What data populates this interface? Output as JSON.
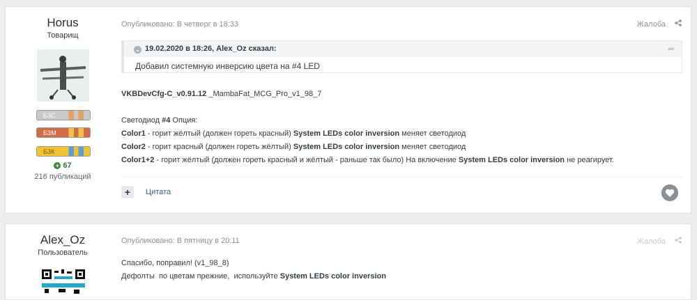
{
  "posts": [
    {
      "author": "Horus",
      "rank": "Товарищ",
      "badges": [
        "БЗС",
        "БЗМ",
        "БЗК"
      ],
      "reputation": "67",
      "posts_count": "216 публикаций",
      "published": "Опубликовано: В четверг в 18:33",
      "report": "Жалоба",
      "quote": {
        "header": "19.02.2020 в 18:26, Alex_Oz сказал:",
        "body": "Добавил системную инверсию цвета на #4 LED"
      },
      "lines": [
        {
          "bold": "VKBDevCfg-C_v0.91.12",
          "text": " _MambaFat_MCG_Pro_v1_98_7"
        },
        {
          "prefix": "Светодиод ",
          "bold": "#4",
          "text": " Опция:"
        },
        {
          "bold": "Color1",
          "text": " - горит жёлтый (должен гореть красный) ",
          "bold2": "System LEDs color inversion",
          "text2": " меняет светодиод"
        },
        {
          "bold": "Color2",
          "text": " - горит красный (должен гореть жёлтый) ",
          "bold2": "System LEDs color inversion",
          "text2": " меняет светодиод"
        },
        {
          "bold": "Color1+2",
          "text": " - горит жёлтый (должен гореть красный и жёлтый - раньше так было) На включение ",
          "bold2": "System LEDs color inversion",
          "text2": " не реагирует."
        }
      ],
      "multiquote_label": "+",
      "cite_label": "Цитата"
    },
    {
      "author": "Alex_Oz",
      "rank": "Пользователь",
      "published": "Опубликовано: В пятницу в 20:11",
      "report": "Жалоба",
      "lines": [
        {
          "text": "Спасибо, поправил! (v1_98_8)"
        },
        {
          "text": "Дефолты  по цветам прежние,  используйте ",
          "bold2": "System LEDs color inversion"
        }
      ]
    }
  ]
}
